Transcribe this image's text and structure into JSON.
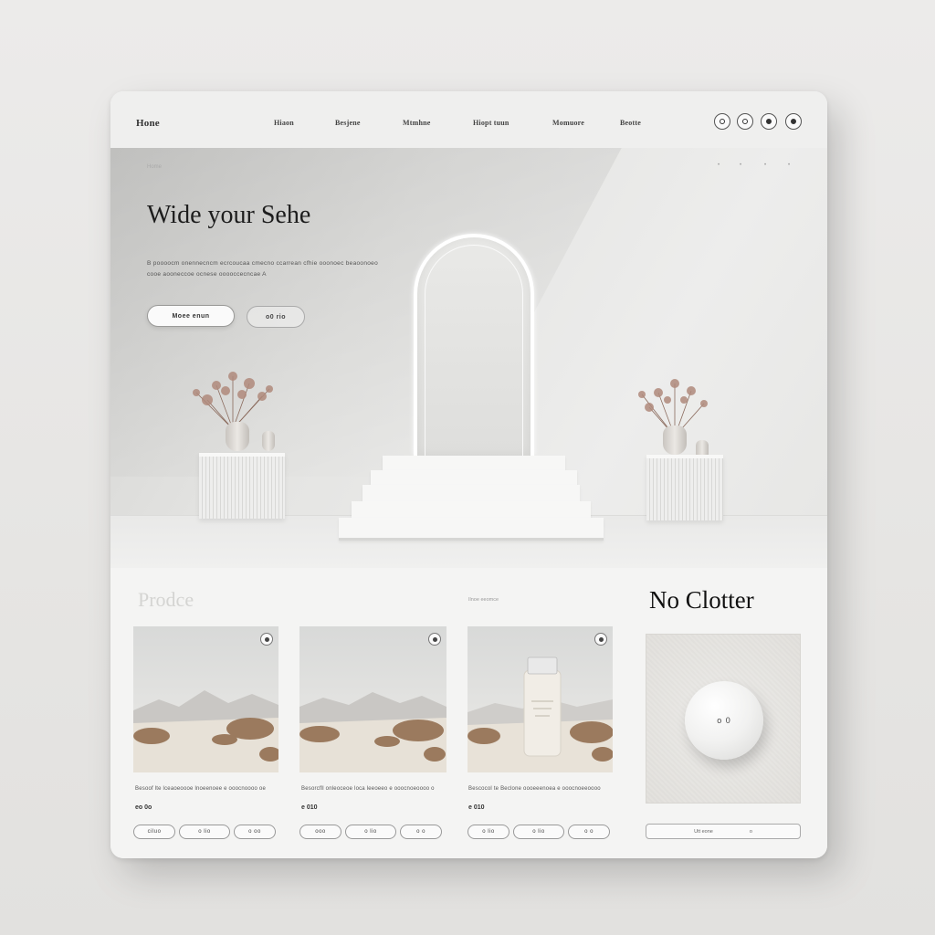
{
  "nav": {
    "brand": "Hone",
    "links": [
      "Hiaon",
      "Besjene",
      "Mtmhne",
      "Hiopt tuun",
      "Momuore",
      "Beotte"
    ],
    "icons": [
      "user-icon",
      "search-icon",
      "favorite-icon",
      "cart-icon"
    ]
  },
  "hero": {
    "breadcrumb": "Home",
    "title": "Wide your Sehe",
    "description": "B poooocm onennecncm ecrcoucaa cmecno ccarrean cfhie ooonoec beaoonoeo cooe aooneccoe ocnese ooooccecncae A",
    "primary_button": "Moee enun",
    "secondary_button": "o0 rio"
  },
  "products": {
    "heading": "Prodce",
    "subheading": "Ilnoe eeomce",
    "items": [
      {
        "description": "Besoof lte lceaoeoooe lnoeenoee e ooocnoooo oe",
        "price": "eo 0o",
        "buttons": [
          "ciluo",
          "o lio",
          "o oo"
        ]
      },
      {
        "description": "Besorcfll onleoceoe loca leeoeeo e ooocnoeoooo o",
        "price": "e 010",
        "buttons": [
          "ooo",
          "o lio",
          "o o"
        ]
      },
      {
        "description": "Bescocol te Beclone oooeeenoea e ooocnoeeoooo",
        "price": "e 010",
        "buttons": [
          "o lio",
          "o lio",
          "o o"
        ]
      }
    ]
  },
  "feature": {
    "title": "No Clotter",
    "device_label": "o 0",
    "button_left": "Utt eone",
    "button_right": "o"
  },
  "colors": {
    "background": "#e6e5e3",
    "panel": "#f3f3f2",
    "title_text": "#1d1d1d"
  }
}
